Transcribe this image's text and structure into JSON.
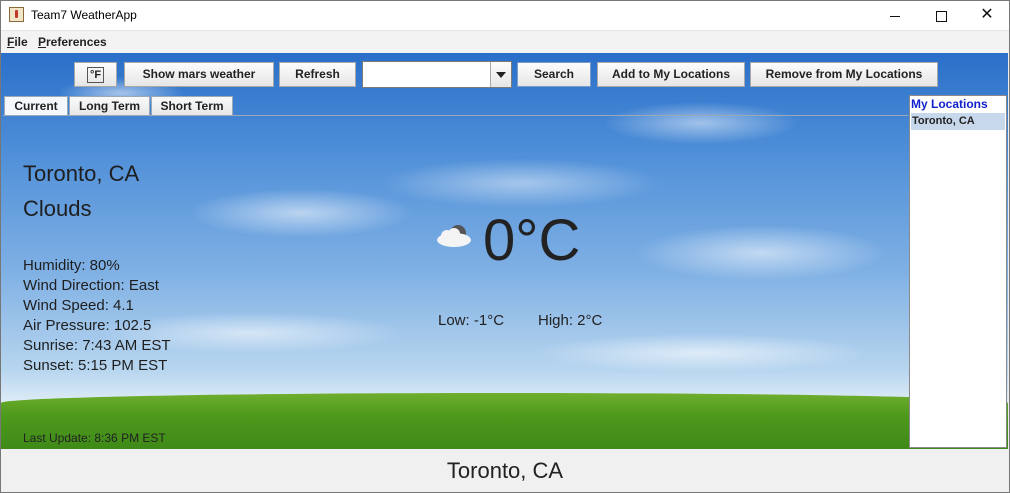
{
  "window": {
    "title": "Team7 WeatherApp",
    "controls": {
      "minimize": "",
      "maximize": "",
      "close": "✕"
    }
  },
  "menu": {
    "file": "File",
    "preferences": "Preferences"
  },
  "toolbar": {
    "unit_toggle": "°F",
    "mars_button": "Show mars weather",
    "refresh_button": "Refresh",
    "search_value": "",
    "search_button": "Search",
    "add_button": "Add to My Locations",
    "remove_button": "Remove from My Locations"
  },
  "tabs": [
    {
      "label": "Current",
      "active": true
    },
    {
      "label": "Long Term",
      "active": false
    },
    {
      "label": "Short Term",
      "active": false
    }
  ],
  "current": {
    "city": "Toronto, CA",
    "condition": "Clouds",
    "details": [
      "Humidity: 80%",
      "Wind Direction: East",
      "Wind Speed: 4.1",
      "Air Pressure: 102.5",
      "Sunrise: 7:43 AM EST",
      "Sunset: 5:15 PM EST"
    ],
    "icon": "cloud-icon",
    "temperature": "0°C",
    "low": "Low: -1°C",
    "high": "High: 2°C",
    "last_update": "Last Update: 8:36 PM EST"
  },
  "my_locations": {
    "title": "My Locations",
    "items": [
      "Toronto, CA"
    ]
  },
  "status": {
    "city": "Toronto, CA"
  },
  "colors": {
    "sky": "#4f8fd8",
    "grass": "#4e9a1c",
    "locations_title": "#0f1fcc",
    "selected_location": "#c8d8ec"
  }
}
